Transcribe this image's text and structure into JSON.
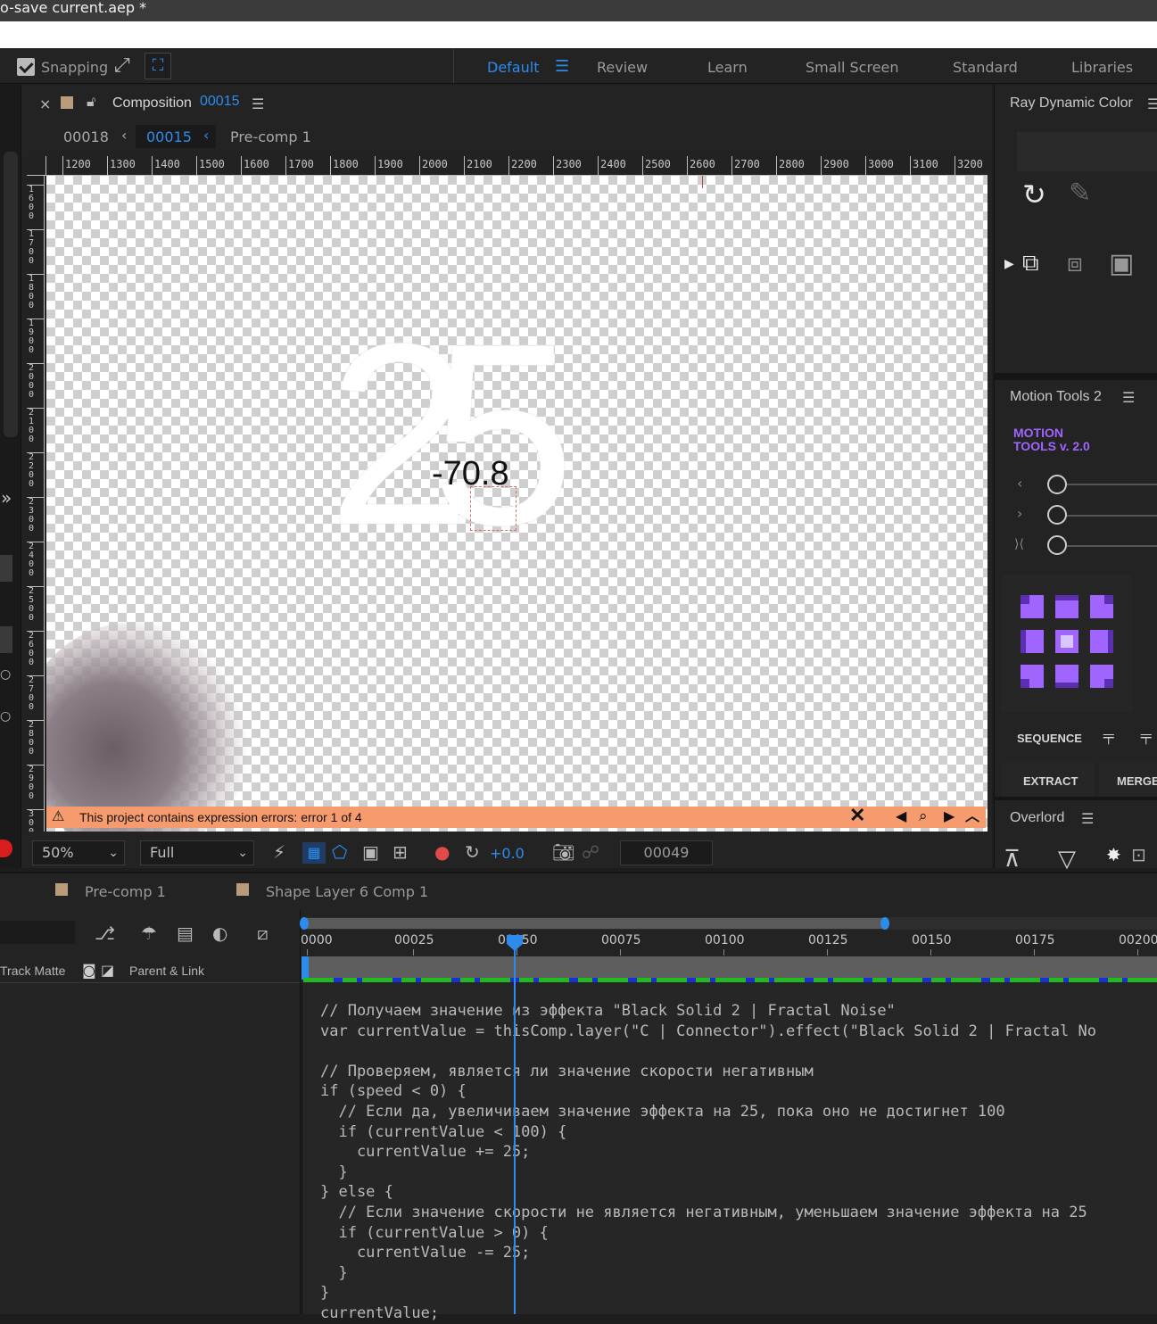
{
  "window": {
    "title": "o-save current.aep *"
  },
  "toolbar": {
    "snapping_label": "Snapping",
    "workspaces": [
      {
        "label": "Default",
        "active": true
      },
      {
        "label": "Review",
        "active": false
      },
      {
        "label": "Learn",
        "active": false
      },
      {
        "label": "Small Screen",
        "active": false
      },
      {
        "label": "Standard",
        "active": false
      },
      {
        "label": "Libraries",
        "active": false
      }
    ]
  },
  "composition": {
    "panel_label": "Composition",
    "name": "00015",
    "breadcrumb": [
      "00018",
      "00015",
      "Pre-comp 1"
    ],
    "ruler_h": [
      "1200",
      "1300",
      "1400",
      "1500",
      "1600",
      "1700",
      "1800",
      "1900",
      "2000",
      "2100",
      "2200",
      "2300",
      "2400",
      "2500",
      "2600",
      "2700",
      "2800",
      "2900",
      "3000",
      "3100",
      "3200"
    ],
    "ruler_v": [
      "1\n6\n0\n0",
      "1\n7\n0\n0",
      "1\n8\n0\n0",
      "1\n9\n0\n0",
      "2\n0\n0\n0",
      "2\n1\n0\n0",
      "2\n2\n0\n0",
      "2\n3\n0\n0",
      "2\n4\n0\n0",
      "2\n5\n0\n0",
      "2\n6\n0\n0",
      "2\n7\n0\n0",
      "2\n8\n0\n0",
      "2\n9\n0\n0",
      "3\n0\n0"
    ],
    "big_number": "25",
    "value_text": "-70.8",
    "error_message": "This project contains expression errors: error 1 of 4"
  },
  "viewer_controls": {
    "zoom": "50%",
    "resolution": "Full",
    "exposure": "+0.0",
    "current_frame": "00049"
  },
  "right_panel": {
    "ray_title": "Ray Dynamic Color",
    "motion_title": "Motion Tools 2",
    "motion_logo_line1": "MOTION",
    "motion_logo_line2": "TOOLS v. 2.0",
    "sequence_label": "SEQUENCE",
    "extract_label": "EXTRACT",
    "merge_label": "MERGE",
    "overlord_title": "Overlord"
  },
  "timeline": {
    "tabs": [
      "Pre-comp 1",
      "Shape Layer 6 Comp 1"
    ],
    "columns": {
      "track_matte": "Track Matte",
      "parent_link": "Parent & Link"
    },
    "ruler_labels": [
      "0000",
      "00025",
      "00050",
      "00075",
      "00100",
      "00125",
      "00150",
      "00175",
      "00200"
    ]
  },
  "expression_lines": [
    "// Получаем значение из эффекта \"Black Solid 2 | Fractal Noise\"",
    "var currentValue = thisComp.layer(\"C | Connector\").effect(\"Black Solid 2 | Fractal No",
    "",
    "// Проверяем, является ли значение скорости негативным",
    "if (speed < 0) {",
    "  // Если да, увеличиваем значение эффекта на 25, пока оно не достигнет 100",
    "  if (currentValue < 100) {",
    "    currentValue += 25;",
    "  }",
    "} else {",
    "  // Если значение скорости не является негативным, уменьшаем значение эффекта на 25",
    "  if (currentValue > 0) {",
    "    currentValue -= 25;",
    "  }",
    "}",
    "currentValue;"
  ],
  "colors": {
    "accent": "#2d8ceb",
    "error_bar": "#f59b6d",
    "motion_purple": "#a064ff",
    "work_area_green": "#21b821",
    "work_area_blue": "#1a2fd6"
  }
}
